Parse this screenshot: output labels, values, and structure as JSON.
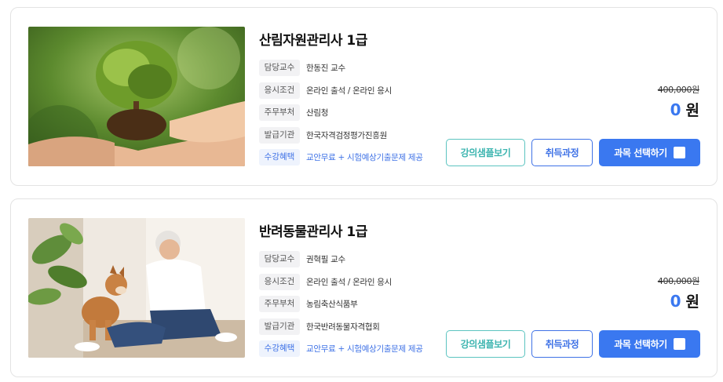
{
  "courses": [
    {
      "image": "tree-in-hands-photo",
      "title": "산림자원관리사 1급",
      "info": [
        {
          "label": "담당교수",
          "value": "한동진 교수"
        },
        {
          "label": "응시조건",
          "value": "온라인 출석 / 온라인 응시"
        },
        {
          "label": "주무부처",
          "value": "산림청"
        },
        {
          "label": "발급기관",
          "value": "한국자격검정평가진흥원"
        },
        {
          "label": "수강혜택",
          "value": "교안무료 + 시험예상기출문제 제공"
        }
      ],
      "price_original": "400,000원",
      "price_final": "0",
      "price_unit": "원",
      "buttons": {
        "sample": "강의샘플보기",
        "cert": "취득과정",
        "select": "과목 선택하기"
      }
    },
    {
      "image": "man-with-dog-photo",
      "title": "반려동물관리사 1급",
      "info": [
        {
          "label": "담당교수",
          "value": "권혁필 교수"
        },
        {
          "label": "응시조건",
          "value": "온라인 출석 / 온라인 응시"
        },
        {
          "label": "주무부처",
          "value": "농림축산식품부"
        },
        {
          "label": "발급기관",
          "value": "한국반려동물자격협회"
        },
        {
          "label": "수강혜택",
          "value": "교안무료 + 시험예상기출문제 제공"
        }
      ],
      "price_original": "400,000원",
      "price_final": "0",
      "price_unit": "원",
      "buttons": {
        "sample": "강의샘플보기",
        "cert": "취득과정",
        "select": "과목 선택하기"
      }
    }
  ],
  "colors": {
    "accent": "#3a78f0",
    "teal": "#3db5b0",
    "benefit": "#3f72e6"
  }
}
